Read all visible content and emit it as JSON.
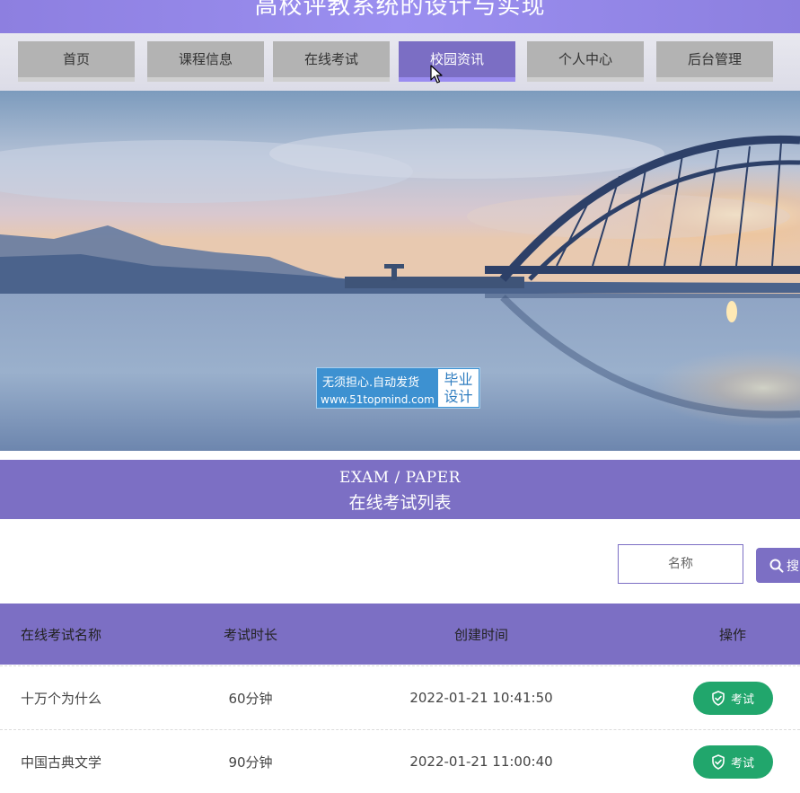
{
  "header": {
    "title": "高校评教系统的设计与实现"
  },
  "nav": [
    {
      "label": "首页"
    },
    {
      "label": "课程信息"
    },
    {
      "label": "在线考试"
    },
    {
      "label": "校园资讯"
    },
    {
      "label": "个人中心"
    },
    {
      "label": "后台管理"
    }
  ],
  "nav_active": "校园资讯",
  "watermark": {
    "line1": "无须担心.自动发货",
    "line2": "www.51topmind.com",
    "badge_line1": "毕业",
    "badge_line2": "设计"
  },
  "section": {
    "title_en": "EXAM / PAPER",
    "title_cn": "在线考试列表"
  },
  "search": {
    "placeholder": "名称",
    "button_label": "搜"
  },
  "table": {
    "headers": [
      "在线考试名称",
      "考试时长",
      "创建时间",
      "操作"
    ],
    "rows": [
      {
        "name": "十万个为什么",
        "duration": "60分钟",
        "created": "2022-01-21 10:41:50",
        "action": "考试"
      },
      {
        "name": "中国古典文学",
        "duration": "90分钟",
        "created": "2022-01-21 11:00:40",
        "action": "考试"
      }
    ]
  },
  "colors": {
    "accent": "#7c6fc4",
    "header": "#9184e6",
    "action_green": "#21a66c"
  },
  "icons": [
    "cursor-icon",
    "search-icon",
    "shield-check-icon"
  ]
}
